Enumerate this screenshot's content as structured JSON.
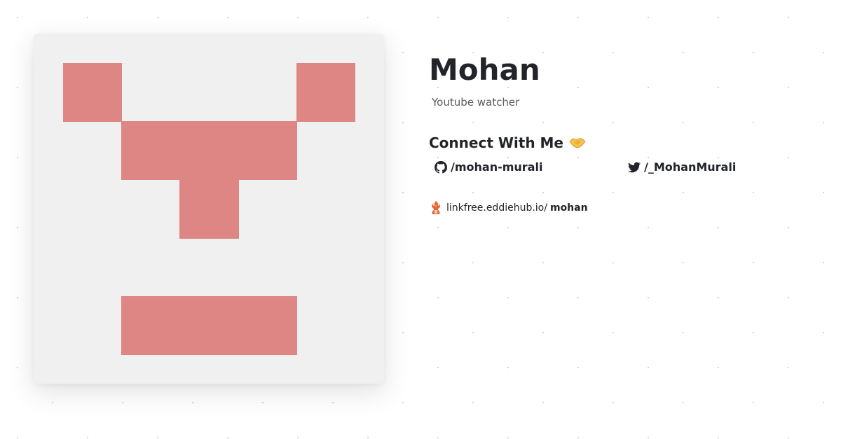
{
  "profile": {
    "name": "Mohan",
    "bio": "Youtube watcher",
    "avatar_color": "#de8683",
    "avatar_background": "#f0f0f0"
  },
  "connect": {
    "heading": "Connect With Me",
    "heading_icon": "handshake-icon",
    "links": [
      {
        "icon": "github-icon",
        "label": "/mohan-murali"
      },
      {
        "icon": "twitter-icon",
        "label": "/_MohanMurali"
      }
    ]
  },
  "footer": {
    "icon": "linkfree-logo-icon",
    "domain": "linkfree.eddiehub.io/",
    "username": "mohan"
  }
}
